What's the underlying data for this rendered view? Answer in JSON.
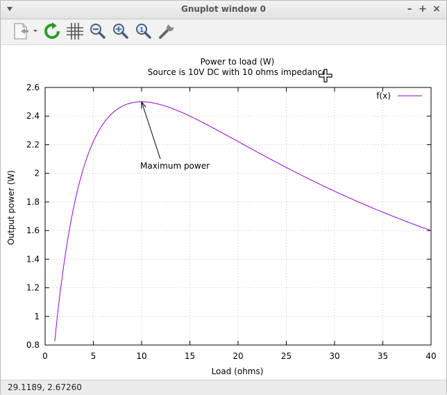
{
  "window": {
    "title": "Gnuplot window 0",
    "minimize_label": "–",
    "maximize_label": "+",
    "close_label": "×"
  },
  "toolbar": {
    "buttons": [
      {
        "icon": "export-icon",
        "tooltip": ""
      },
      {
        "icon": "replot-icon",
        "tooltip": ""
      },
      {
        "icon": "grid-icon",
        "tooltip": ""
      },
      {
        "icon": "zoom-out-icon",
        "tooltip": ""
      },
      {
        "icon": "zoom-in-icon",
        "tooltip": ""
      },
      {
        "icon": "zoom-reset-icon",
        "tooltip": ""
      },
      {
        "icon": "settings-wrench-icon",
        "tooltip": ""
      }
    ]
  },
  "chart_data": {
    "type": "line",
    "title": "Power to load (W)",
    "subtitle": "Source is 10V DC with 10 ohms impedance",
    "xlabel": "Load (ohms)",
    "ylabel": "Output power (W)",
    "xlim": [
      0,
      40
    ],
    "ylim": [
      0.8,
      2.6
    ],
    "xticks": [
      "0",
      "5",
      "10",
      "15",
      "20",
      "25",
      "30",
      "35",
      "40"
    ],
    "yticks": [
      "0.8",
      "1",
      "1.2",
      "1.4",
      "1.6",
      "1.8",
      "2",
      "2.2",
      "2.4",
      "2.6"
    ],
    "grid": true,
    "legend_position": "top-right",
    "series": [
      {
        "name": "f(x)",
        "color": "#9400d3",
        "function": "100*x/(10+x)^2",
        "x_range": [
          1,
          40
        ],
        "sample_points": [
          {
            "x": 1,
            "y": 0.826
          },
          {
            "x": 2.5,
            "y": 1.6
          },
          {
            "x": 5,
            "y": 2.222
          },
          {
            "x": 7.5,
            "y": 2.449
          },
          {
            "x": 10,
            "y": 2.5
          },
          {
            "x": 15,
            "y": 2.4
          },
          {
            "x": 20,
            "y": 2.222
          },
          {
            "x": 25,
            "y": 2.041
          },
          {
            "x": 30,
            "y": 1.875
          },
          {
            "x": 35,
            "y": 1.728
          },
          {
            "x": 40,
            "y": 1.6
          }
        ]
      }
    ],
    "annotations": [
      {
        "text": "Maximum power",
        "point_x": 10,
        "point_y": 2.5
      }
    ]
  },
  "status": {
    "coordinates": "29.1189,  2.67260"
  }
}
